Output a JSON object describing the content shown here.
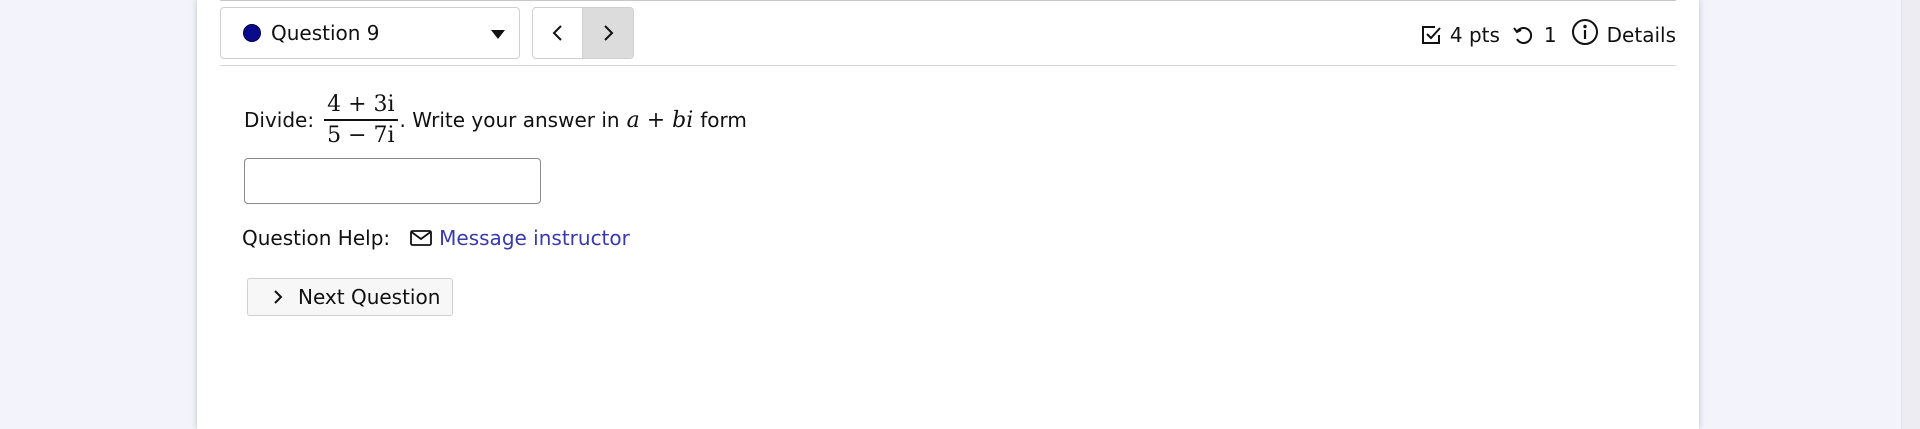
{
  "header": {
    "question_selector": {
      "label": "Question 9",
      "status_color": "#0a0a8c"
    },
    "nav": {
      "prev_icon": "chevron-left-icon",
      "next_icon": "chevron-right-icon"
    },
    "meta": {
      "points": "4 pts",
      "attempts": "1",
      "details_label": "Details"
    }
  },
  "question": {
    "prefix": "Divide:",
    "fraction_numerator": "4 + 3i",
    "fraction_denominator": "5 − 7i",
    "middle": ". Write your answer in",
    "form_expression": "a + bi",
    "suffix": "form",
    "answer_value": "",
    "answer_placeholder": ""
  },
  "help": {
    "label": "Question Help:",
    "message_link": "Message instructor",
    "link_color": "#3a3aa8"
  },
  "next_button": {
    "label": "Next Question"
  }
}
